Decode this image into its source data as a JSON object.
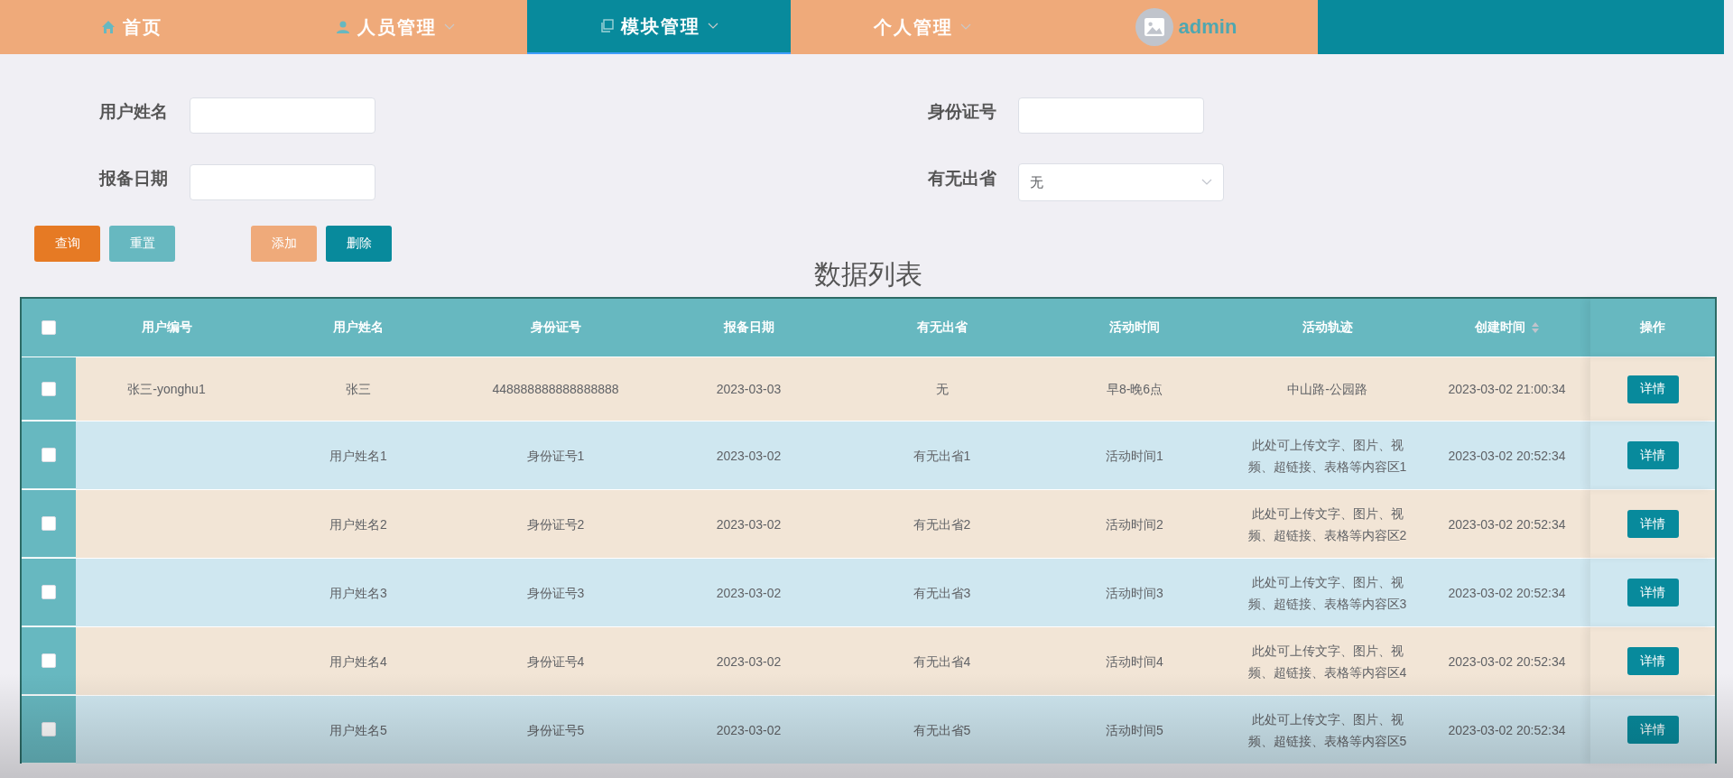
{
  "nav": {
    "items": [
      {
        "label": "首页",
        "dropdown": false,
        "selected": false
      },
      {
        "label": "人员管理",
        "dropdown": true,
        "selected": false
      },
      {
        "label": "模块管理",
        "dropdown": true,
        "selected": true
      },
      {
        "label": "个人管理",
        "dropdown": true,
        "selected": false
      }
    ],
    "user": {
      "name": "admin"
    }
  },
  "search": {
    "fields": [
      {
        "label": "用户姓名",
        "kind": "input"
      },
      {
        "label": "身份证号",
        "kind": "input"
      },
      {
        "label": "报备日期",
        "kind": "input"
      },
      {
        "label": "有无出省",
        "kind": "select",
        "value": "无"
      }
    ]
  },
  "actions": [
    {
      "label": "查询",
      "kind": "search"
    },
    {
      "label": "重置",
      "kind": "reset"
    },
    {
      "label": "添加",
      "kind": "add"
    },
    {
      "label": "删除",
      "kind": "delete"
    }
  ],
  "table": {
    "title": "数据列表",
    "select_all": {
      "checked": false
    },
    "columns": [
      {
        "label": "用户编号",
        "sortable": false
      },
      {
        "label": "用户姓名",
        "sortable": false
      },
      {
        "label": "身份证号",
        "sortable": false
      },
      {
        "label": "报备日期",
        "sortable": false
      },
      {
        "label": "有无出省",
        "sortable": false
      },
      {
        "label": "活动时间",
        "sortable": false
      },
      {
        "label": "活动轨迹",
        "sortable": false
      },
      {
        "label": "创建时间",
        "sortable": true
      },
      {
        "label": "操作",
        "sortable": false
      }
    ],
    "rows": [
      {
        "checked": false,
        "cells": [
          "张三-yonghu1",
          "张三",
          "448888888888888888",
          "2023-03-03",
          "无",
          "早8-晚6点",
          "中山路-公园路",
          "2023-03-02 21:00:34"
        ],
        "action": "详情"
      },
      {
        "checked": false,
        "cells": [
          null,
          "用户姓名1",
          "身份证号1",
          "2023-03-02",
          "有无出省1",
          "活动时间1",
          "此处可上传文字、图片、视频、超链接、表格等内容区1",
          "2023-03-02 20:52:34"
        ],
        "action": "详情"
      },
      {
        "checked": false,
        "cells": [
          null,
          "用户姓名2",
          "身份证号2",
          "2023-03-02",
          "有无出省2",
          "活动时间2",
          "此处可上传文字、图片、视频、超链接、表格等内容区2",
          "2023-03-02 20:52:34"
        ],
        "action": "详情"
      },
      {
        "checked": false,
        "cells": [
          null,
          "用户姓名3",
          "身份证号3",
          "2023-03-02",
          "有无出省3",
          "活动时间3",
          "此处可上传文字、图片、视频、超链接、表格等内容区3",
          "2023-03-02 20:52:34"
        ],
        "action": "详情"
      },
      {
        "checked": false,
        "cells": [
          null,
          "用户姓名4",
          "身份证号4",
          "2023-03-02",
          "有无出省4",
          "活动时间4",
          "此处可上传文字、图片、视频、超链接、表格等内容区4",
          "2023-03-02 20:52:34"
        ],
        "action": "详情"
      },
      {
        "checked": false,
        "cells": [
          null,
          "用户姓名5",
          "身份证号5",
          "2023-03-02",
          "有无出省5",
          "活动时间5",
          "此处可上传文字、图片、视频、超链接、表格等内容区5",
          "2023-03-02 20:52:34"
        ],
        "action": "详情"
      }
    ]
  }
}
